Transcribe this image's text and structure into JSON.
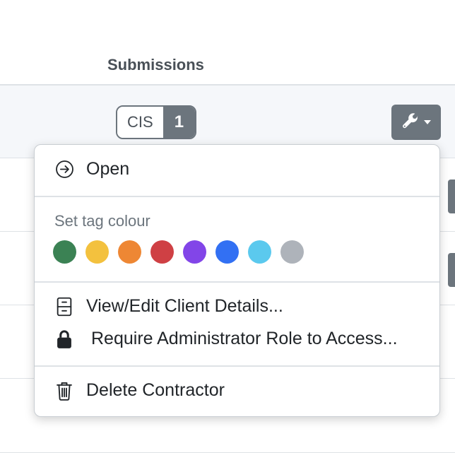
{
  "table": {
    "column_header": "Submissions",
    "row1": {
      "badge_label": "CIS",
      "badge_count": "1"
    }
  },
  "menu": {
    "open_label": "Open",
    "tag_colour_label": "Set tag colour",
    "tag_colours": [
      "#3b8254",
      "#f3c13e",
      "#ee8734",
      "#cf4044",
      "#8245e8",
      "#3270f3",
      "#5bc9ee",
      "#aeb3ba"
    ],
    "view_edit_label": "View/Edit Client Details...",
    "require_admin_label": "Require Administrator Role to Access...",
    "delete_label": "Delete Contractor"
  },
  "icons": {
    "open": "arrow-circle-right-icon",
    "view_edit": "file-cabinet-icon",
    "require_admin": "lock-icon",
    "delete": "trash-icon",
    "actions": "wrench-icon"
  }
}
